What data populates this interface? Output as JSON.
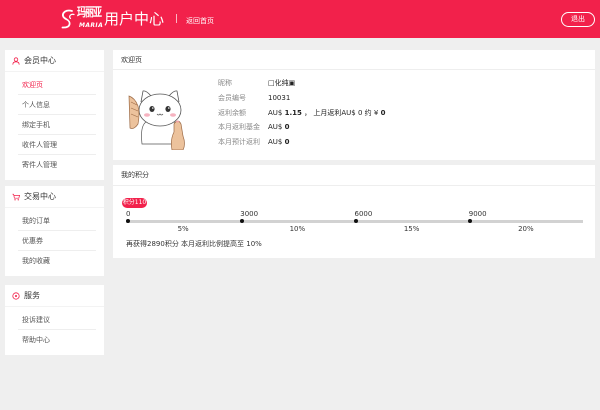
{
  "colors": {
    "brand": "#f2214b",
    "page_bg": "#efefef"
  },
  "header": {
    "logo_icon": "swirl-logo-icon",
    "logo_cn": "玛丽亚",
    "logo_en": "MARIA",
    "title": "用户中心",
    "divider": "|",
    "home_link": "返回首页",
    "logout": "退出"
  },
  "sidebar": {
    "active_index": 0,
    "member": {
      "icon": "user-icon",
      "title": "会员中心",
      "items": [
        "欢迎页",
        "个人信息",
        "绑定手机",
        "收件人管理",
        "寄件人管理"
      ]
    },
    "trade": {
      "icon": "cart-icon",
      "title": "交易中心",
      "items": [
        "我的订单",
        "优惠券",
        "我的收藏"
      ]
    },
    "service": {
      "icon": "service-icon",
      "title": "服务",
      "items": [
        "投诉建议",
        "帮助中心"
      ]
    }
  },
  "welcome": {
    "title": "欢迎页",
    "avatar": "cat-avatar",
    "nickname": {
      "label": "昵称",
      "value": "□化纯▣"
    },
    "member_no": {
      "label": "会员编号",
      "value": "10031"
    },
    "rebate_balance": {
      "label": "返利余额",
      "currency": "AU$",
      "amount": "1.15",
      "last_month_text": "， 上月返利AU$",
      "last_month_amount": "0",
      "approx_text": "约 ¥",
      "approx_amount": "0"
    },
    "month_fund": {
      "label": "本月返利基金",
      "currency": "AU$",
      "amount": "0"
    },
    "month_estimate": {
      "label": "本月预计返利",
      "currency": "AU$",
      "amount": "0"
    }
  },
  "points": {
    "title": "我的积分",
    "badge": "积分110",
    "ticks": [
      "0",
      "3000",
      "6000",
      "9000"
    ],
    "rates": [
      "5%",
      "10%",
      "15%",
      "20%"
    ],
    "note": "再获得2890积分 本月返利比例提高至 10%"
  }
}
